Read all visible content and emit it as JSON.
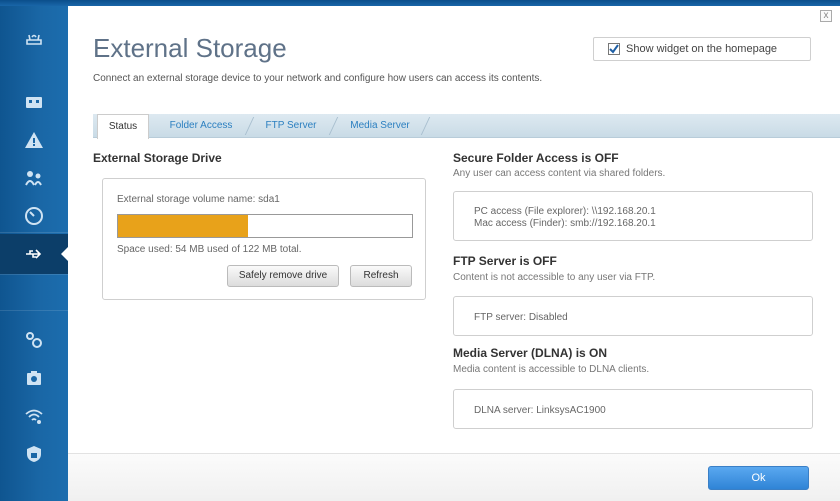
{
  "page": {
    "title": "External Storage",
    "subtitle": "Connect an external storage device to your network and configure how users can access its contents.",
    "close_label": "x",
    "widget": {
      "label": "Show widget on the homepage",
      "checked": true
    }
  },
  "sidebar": {
    "items": [
      {
        "icon": "router-icon"
      },
      {
        "icon": "device-list-icon"
      },
      {
        "icon": "network-map-alert-icon"
      },
      {
        "icon": "parental-controls-icon"
      },
      {
        "icon": "speed-test-icon"
      },
      {
        "icon": "usb-storage-icon",
        "active": true
      },
      {
        "icon": "connectivity-settings-icon"
      },
      {
        "icon": "troubleshooting-icon"
      },
      {
        "icon": "wireless-icon"
      },
      {
        "icon": "security-icon"
      }
    ]
  },
  "tabs": [
    {
      "label": "Status",
      "active": true
    },
    {
      "label": "Folder Access"
    },
    {
      "label": "FTP Server"
    },
    {
      "label": "Media Server"
    }
  ],
  "drive": {
    "heading": "External Storage Drive",
    "volume_label": "External storage volume name: sda1",
    "usage_fraction": 0.443,
    "space_used": "Space used: 54 MB used of 122 MB total.",
    "remove_button": "Safely remove drive",
    "refresh_button": "Refresh"
  },
  "secure_folder": {
    "heading": "Secure Folder Access is OFF",
    "desc": "Any user can access content via shared folders.",
    "pc_access": "PC access (File explorer): \\\\192.168.20.1",
    "mac_access": "Mac access (Finder): smb://192.168.20.1"
  },
  "ftp": {
    "heading": "FTP Server is OFF",
    "desc": "Content is not accessible to any user via FTP.",
    "status": "FTP server: Disabled"
  },
  "media": {
    "heading": "Media Server (DLNA) is ON",
    "desc": "Media content is accessible to DLNA clients.",
    "status": "DLNA server: LinksysAC1900"
  },
  "footer": {
    "ok_label": "Ok"
  },
  "colors": {
    "sidebar_blue": "#1a67a6",
    "progress_orange": "#e8a21a",
    "tab_link": "#2b7fc0",
    "ok_blue": "#2f84d6"
  }
}
